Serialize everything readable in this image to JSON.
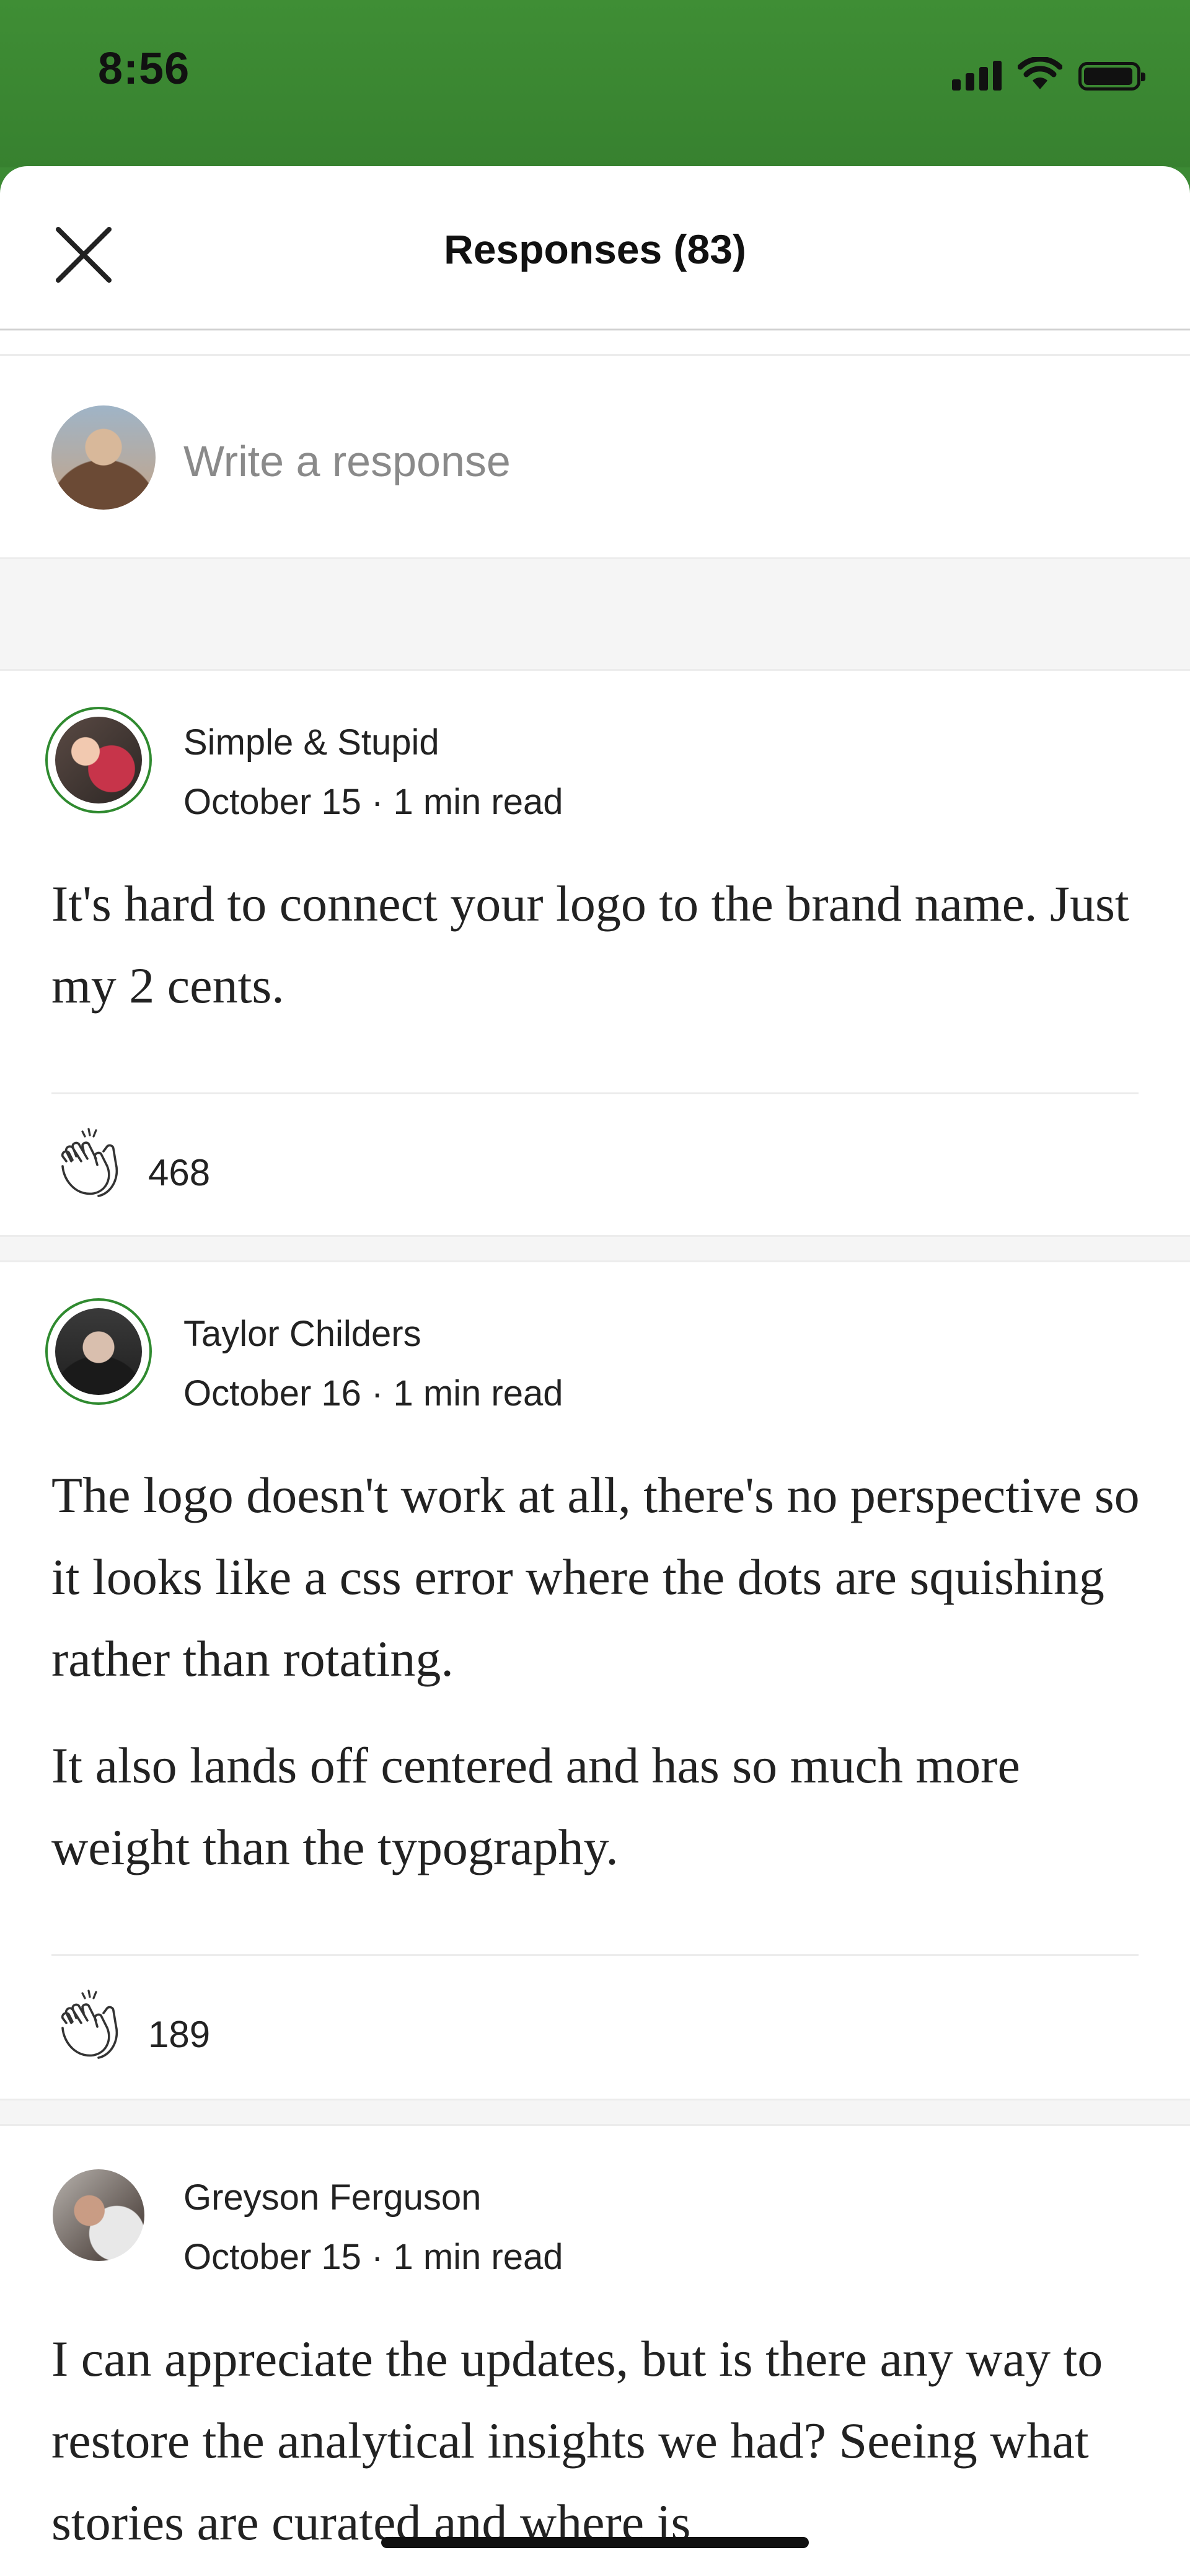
{
  "status_bar": {
    "time": "8:56"
  },
  "header": {
    "title": "Responses (83)"
  },
  "compose": {
    "placeholder": "Write a response"
  },
  "responses": [
    {
      "author": "Simple & Stupid",
      "meta": "October 15 · 1 min read",
      "paragraphs": [
        "It's hard to connect your logo to the brand name. Just my 2 cents."
      ],
      "claps": "468"
    },
    {
      "author": "Taylor Childers",
      "meta": "October 16 · 1 min read",
      "paragraphs": [
        "The logo doesn't work at all, there's no perspective so it looks like a css error where the dots are squishing rather than rotating.",
        "It also lands off centered and has so much more weight than the typography."
      ],
      "claps": "189"
    },
    {
      "author": "Greyson Ferguson",
      "meta": "October 15 · 1 min read",
      "paragraphs": [
        "I can appreciate the updates, but is there any way to restore the analytical insights we had? Seeing what stories are curated and where is"
      ]
    }
  ],
  "colors": {
    "status_bar": "#3c8a34",
    "ring": "#2f8a2f"
  }
}
